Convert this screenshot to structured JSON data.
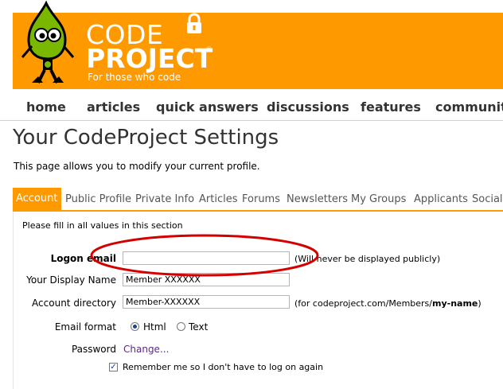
{
  "brand": {
    "line1": "CODE",
    "line2": "PROJECT",
    "registered": "®",
    "tagline": "For those who code",
    "colors": {
      "banner": "#ff9900",
      "text": "#ffffff",
      "mascot": "#7ab800"
    }
  },
  "nav": {
    "items": [
      "home",
      "articles",
      "quick answers",
      "discussions",
      "features",
      "community"
    ]
  },
  "page": {
    "title": "Your CodeProject Settings",
    "description": "This page allows you to modify your current profile."
  },
  "tabs": {
    "items": [
      "Account",
      "Public Profile",
      "Private Info",
      "Articles",
      "Forums",
      "Newsletters",
      "My Groups",
      "Applicants",
      "Social"
    ],
    "active": "Account"
  },
  "form": {
    "note": "Please fill in all values in this section",
    "logon_email": {
      "label": "Logon email",
      "value": "",
      "hint": "(Will never be displayed publicly)"
    },
    "display_name": {
      "label": "Your Display Name",
      "value": "Member XXXXXX"
    },
    "account_directory": {
      "label": "Account directory",
      "value": "Member-XXXXXX",
      "hint_prefix": "(for codeproject.com/Members/",
      "hint_bold": "my-name",
      "hint_suffix": ")"
    },
    "email_format": {
      "label": "Email format",
      "options": [
        "Html",
        "Text"
      ],
      "selected": "Html"
    },
    "password": {
      "label": "Password",
      "link": "Change..."
    },
    "remember": {
      "label": "Remember me so I don't have to log on again",
      "checked": true
    }
  },
  "annotation": {
    "shape": "red-ellipse",
    "color": "#d40000"
  }
}
